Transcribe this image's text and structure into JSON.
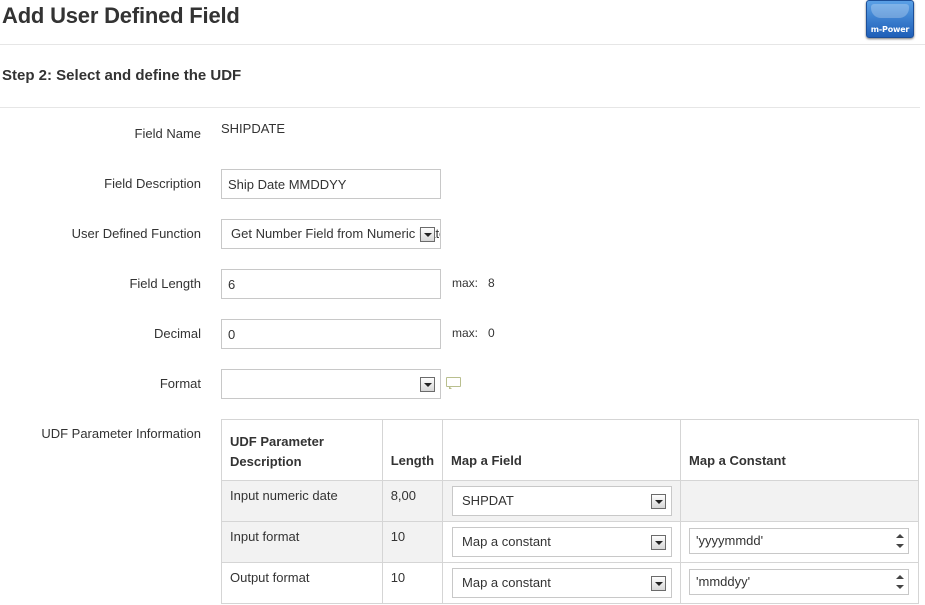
{
  "header": {
    "title": "Add User Defined Field",
    "logo_text": "m-Power"
  },
  "step": {
    "title": "Step 2: Select and define the UDF"
  },
  "form": {
    "field_name": {
      "label": "Field Name",
      "value": "SHIPDATE"
    },
    "field_description": {
      "label": "Field Description",
      "value": "Ship Date MMDDYY"
    },
    "user_defined_function": {
      "label": "User Defined Function",
      "selected": "Get Number Field from Numeric Date"
    },
    "field_length": {
      "label": "Field Length",
      "value": "6",
      "max_label": "max:",
      "max_value": "8"
    },
    "decimal": {
      "label": "Decimal",
      "value": "0",
      "max_label": "max:",
      "max_value": "0"
    },
    "format": {
      "label": "Format",
      "selected": ""
    },
    "udf_params_label": "UDF Parameter Information"
  },
  "param_table": {
    "headers": {
      "description": "UDF Parameter Description",
      "length": "Length",
      "map_field": "Map a Field",
      "map_constant": "Map a Constant"
    },
    "rows": [
      {
        "description": "Input numeric date",
        "length": "8,00",
        "map_field": "SHPDAT",
        "map_constant": null
      },
      {
        "description": "Input format",
        "length": "10",
        "map_field": "Map a constant",
        "map_constant": "'yyyymmdd'"
      },
      {
        "description": "Output format",
        "length": "10",
        "map_field": "Map a constant",
        "map_constant": "'mmddyy'"
      }
    ]
  },
  "colors": {
    "text": "#333333",
    "border": "#c8c8c8",
    "row_shade": "#f2f2f2",
    "logo_blue": "#1f5fb8"
  }
}
